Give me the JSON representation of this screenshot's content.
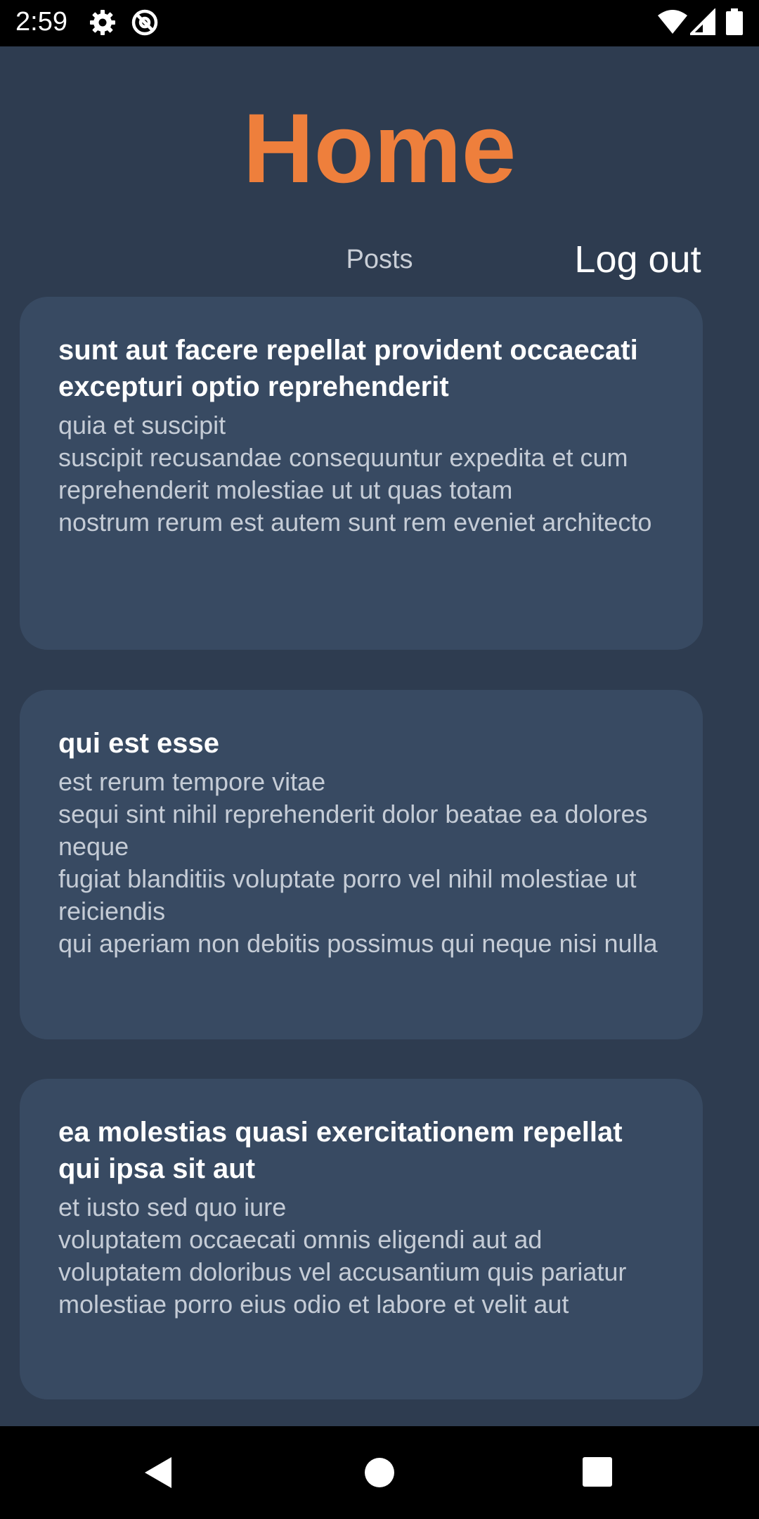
{
  "status_bar": {
    "time": "2:59",
    "icons_left": [
      "gear-icon",
      "at-sign-icon"
    ],
    "icons_right": [
      "wifi-icon",
      "signal-icon",
      "battery-icon"
    ]
  },
  "header": {
    "title": "Home",
    "nav": {
      "posts_label": "Posts",
      "logout_label": "Log out"
    }
  },
  "posts": [
    {
      "title": "sunt aut facere repellat provident occaecati excepturi optio reprehenderit",
      "body": [
        "quia et suscipit",
        "suscipit recusandae consequuntur expedita et cum",
        "reprehenderit molestiae ut ut quas totam",
        "nostrum rerum est autem sunt rem eveniet architecto"
      ]
    },
    {
      "title": "qui est esse",
      "body": [
        "est rerum tempore vitae",
        "sequi sint nihil reprehenderit dolor beatae ea dolores neque",
        "fugiat blanditiis voluptate porro vel nihil molestiae ut reiciendis",
        "qui aperiam non debitis possimus qui neque nisi nulla"
      ]
    },
    {
      "title": "ea molestias quasi exercitationem repellat qui ipsa sit aut",
      "body": [
        "et iusto sed quo iure",
        "voluptatem occaecati omnis eligendi aut ad",
        "voluptatem doloribus vel accusantium quis pariatur",
        "molestiae porro eius odio et labore et velit aut"
      ]
    }
  ],
  "system_nav": [
    "back-icon",
    "home-icon",
    "recents-icon"
  ],
  "colors": {
    "background": "#2e3c50",
    "card": "#384a62",
    "accent": "#ee7f3c",
    "title_text": "#ffffff",
    "body_text": "#c5ccd6"
  }
}
